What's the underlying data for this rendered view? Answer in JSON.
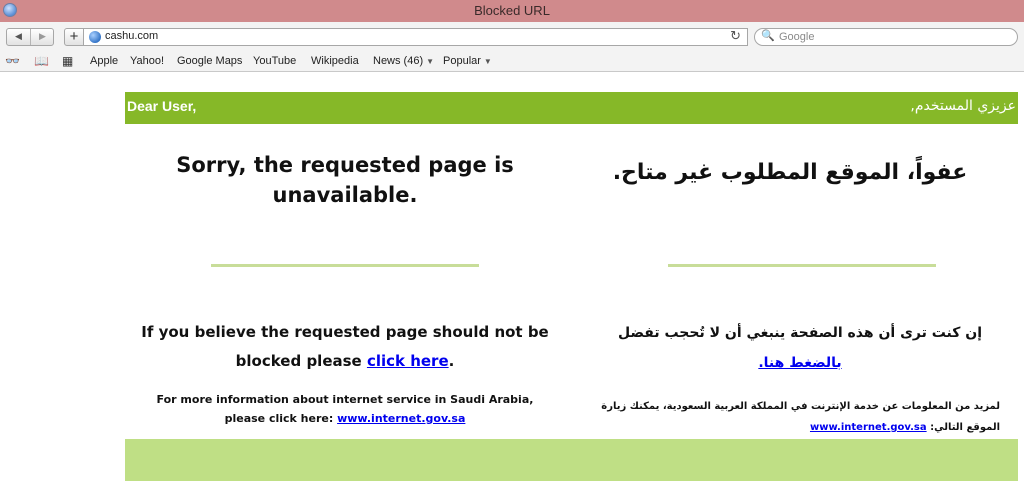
{
  "window": {
    "title": "Blocked URL"
  },
  "toolbar": {
    "back_glyph": "◀",
    "forward_glyph": "▶",
    "add_glyph": "+",
    "url": "cashu.com",
    "reload_glyph": "↻",
    "search_placeholder": "Google",
    "search_glyph": "🔍"
  },
  "bookmarks": {
    "reading_glyph": "👓",
    "book_glyph": "📖",
    "grid_glyph": "▦",
    "items": [
      "Apple",
      "Yahoo!",
      "Google Maps",
      "YouTube",
      "Wikipedia",
      "News (46)",
      "Popular"
    ],
    "caret": "▼"
  },
  "page": {
    "greeting_en": "Dear User,",
    "greeting_ar": "عزيزي المستخدم,",
    "heading_en": "Sorry, the requested page is unavailable.",
    "heading_ar": "عفواً، الموقع المطلوب غير متاح.",
    "body_en_prefix": "If you believe the requested page should not be blocked please ",
    "body_en_link": "click here",
    "body_en_suffix": ".",
    "body_ar_text": "إن كنت ترى أن هذه الصفحة ينبغي أن لا تُحجب تفضل ",
    "body_ar_link": "بالضغط هنا.",
    "info_en_line1": "For more information about internet service in Saudi Arabia,",
    "info_en_line2": "please click here: ",
    "info_link": "www.internet.gov.sa",
    "info_ar_text": "لمزيد من المعلومات عن خدمة الإنترنت في المملكة العربية السعودية، يمكنك زيارة الموقع التالي: "
  },
  "colors": {
    "titlebar": "#d08a8c",
    "header_green": "#86b828",
    "divider_green": "#c8dd99",
    "footer_green": "#bfdf85",
    "link": "#0000ee"
  }
}
